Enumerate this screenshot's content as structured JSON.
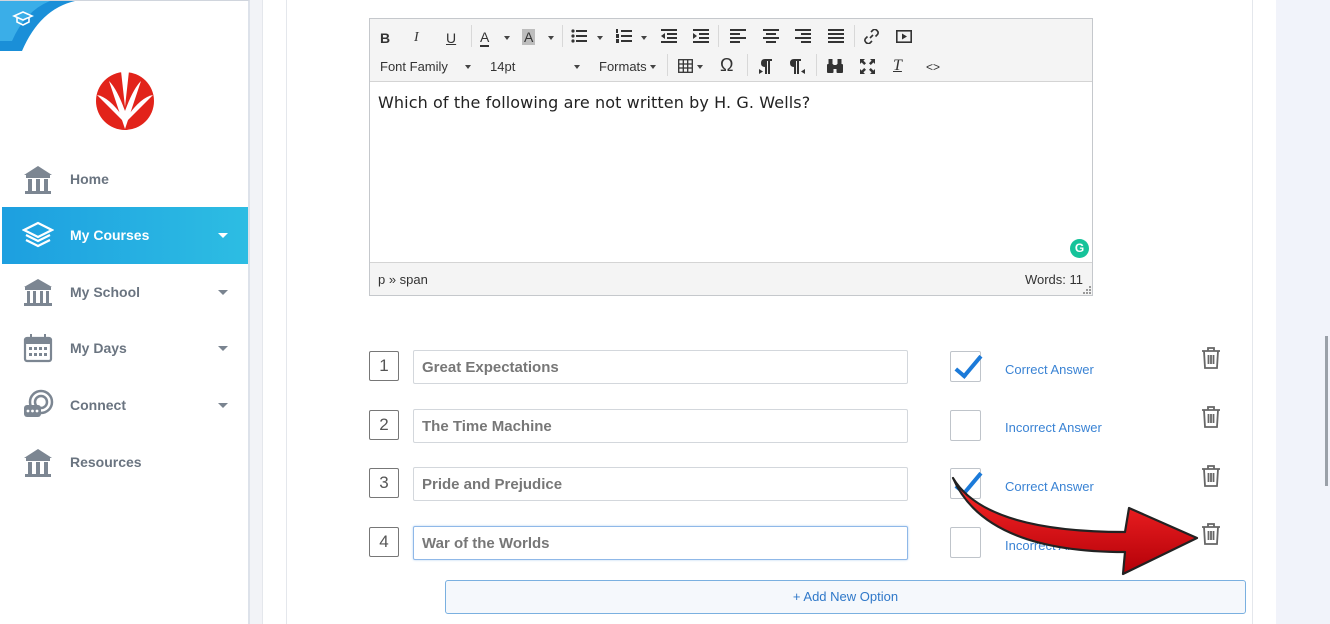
{
  "sidebar": {
    "items": [
      {
        "label": "Home",
        "icon": "home-icon",
        "active": false,
        "has_caret": false
      },
      {
        "label": "My Courses",
        "icon": "courses-icon",
        "active": true,
        "has_caret": true
      },
      {
        "label": "My School",
        "icon": "school-icon",
        "active": false,
        "has_caret": true
      },
      {
        "label": "My Days",
        "icon": "calendar-icon",
        "active": false,
        "has_caret": true
      },
      {
        "label": "Connect",
        "icon": "connect-icon",
        "active": false,
        "has_caret": true
      },
      {
        "label": "Resources",
        "icon": "resources-icon",
        "active": false,
        "has_caret": false
      }
    ],
    "active_color": "#1d9fe0",
    "logo_color": "#e2231a"
  },
  "editor": {
    "toolbar": {
      "font_family": "Font Family",
      "font_size": "14pt",
      "formats": "Formats",
      "bold": "B",
      "italic": "I",
      "underline": "U",
      "text_color": "A",
      "bg_color": "A",
      "omega": "Ω",
      "source": "<>"
    },
    "content": "Which of the following are not written by H. G. Wells?",
    "path": "p » span",
    "word_count": "Words: 11"
  },
  "options": [
    {
      "number": "1",
      "value": "Great Expectations",
      "correct": true,
      "status": "Correct Answer"
    },
    {
      "number": "2",
      "value": "The Time Machine",
      "correct": false,
      "status": "Incorrect Answer"
    },
    {
      "number": "3",
      "value": "Pride and Prejudice",
      "correct": true,
      "status": "Correct Answer"
    },
    {
      "number": "4",
      "value": "War of the Worlds",
      "correct": false,
      "status": "Incorrect Answer"
    }
  ],
  "add_option_label": "+ Add New Option",
  "annotation_arrow_color": "#d4000a"
}
